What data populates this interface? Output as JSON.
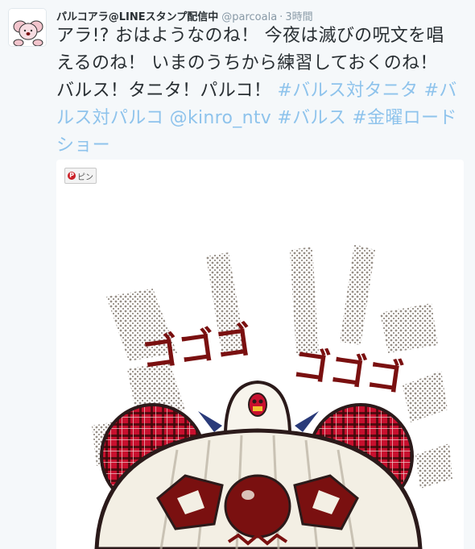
{
  "tweet": {
    "display_name": "パルコアラ@LINEスタンプ配信中",
    "handle": "@parcoala",
    "separator": "·",
    "time": "3時間",
    "text_main": "アラ!? おはようなのね！ 今夜は滅びの呪文を唱えるのね！ いまのうちから練習しておくのね！ バルス！タニタ！パルコ！ ",
    "tags": [
      "#バルス対タニタ",
      "#バルス対パルコ",
      "@kinro_ntv",
      "#バルス",
      "#金曜ロードショー"
    ]
  },
  "media": {
    "pin_label": "ピン",
    "art_text": "ゴゴゴゴゴゴ"
  },
  "colors": {
    "link": "#8ec3ec",
    "plaid_red": "#c8102e",
    "dark_red": "#7a1010",
    "dots": "#8a8178"
  },
  "icons": {
    "avatar": "koala-avatar-icon",
    "pin": "pinterest-icon"
  }
}
